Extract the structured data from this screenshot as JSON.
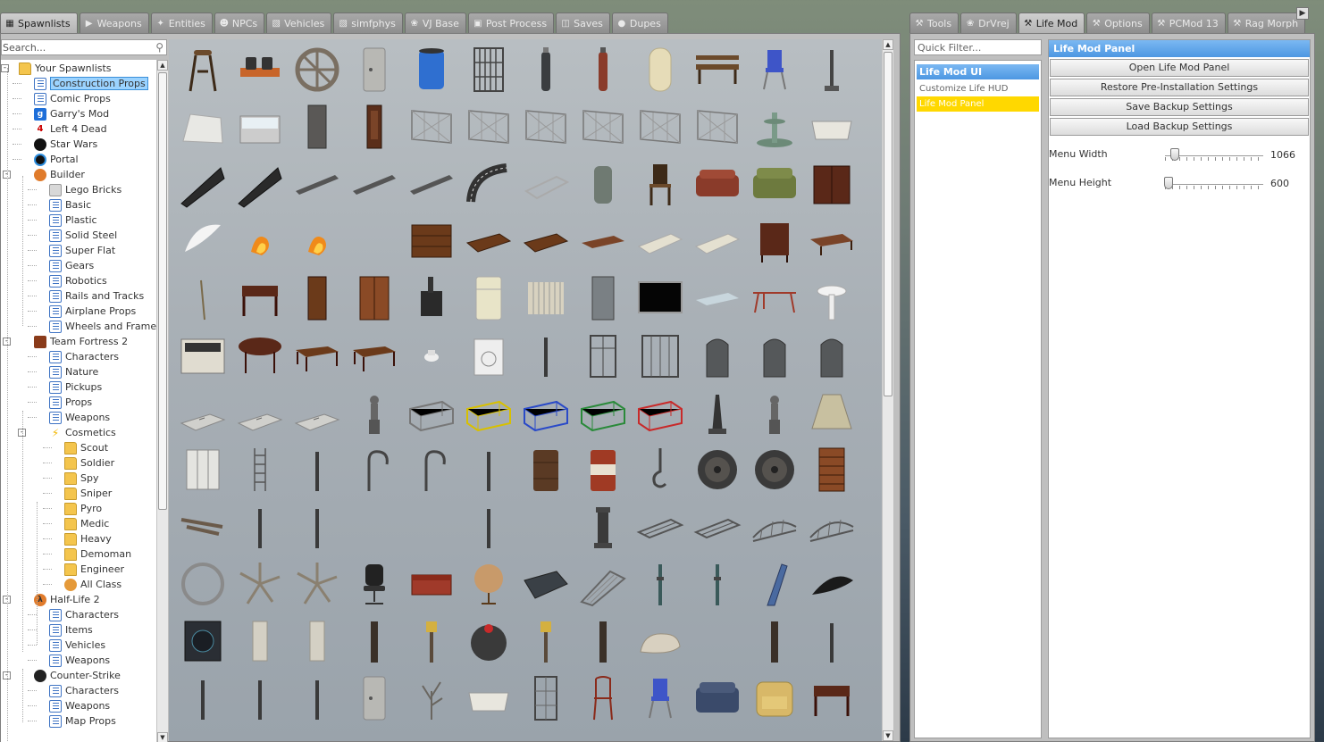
{
  "left_tabs": [
    {
      "label": "Spawnlists",
      "icon": "grid-icon",
      "active": true
    },
    {
      "label": "Weapons",
      "icon": "gun-icon"
    },
    {
      "label": "Entities",
      "icon": "entities-icon"
    },
    {
      "label": "NPCs",
      "icon": "monkey-icon"
    },
    {
      "label": "Vehicles",
      "icon": "car-icon"
    },
    {
      "label": "simfphys",
      "icon": "car-icon"
    },
    {
      "label": "VJ Base",
      "icon": "vj-icon"
    },
    {
      "label": "Post Process",
      "icon": "image-icon"
    },
    {
      "label": "Saves",
      "icon": "save-icon"
    },
    {
      "label": "Dupes",
      "icon": "dupe-icon"
    }
  ],
  "search": {
    "placeholder": "Search..."
  },
  "tree": [
    {
      "label": "Your Spawnlists",
      "icon": "folder",
      "depth": 0,
      "expander": "-"
    },
    {
      "label": "Construction Props",
      "icon": "page",
      "depth": 1,
      "selected": true
    },
    {
      "label": "Comic Props",
      "icon": "page",
      "depth": 1
    },
    {
      "label": "Garry's Mod",
      "icon": "gmod",
      "depth": 1
    },
    {
      "label": "Left 4 Dead",
      "icon": "l4d",
      "depth": 1
    },
    {
      "label": "Star Wars",
      "icon": "sw",
      "depth": 1
    },
    {
      "label": "Portal",
      "icon": "portal",
      "depth": 1
    },
    {
      "label": "Builder",
      "icon": "builder",
      "depth": 1,
      "expander": "-"
    },
    {
      "label": "Lego Bricks",
      "icon": "lego",
      "depth": 2
    },
    {
      "label": "Basic",
      "icon": "page",
      "depth": 2
    },
    {
      "label": "Plastic",
      "icon": "page",
      "depth": 2
    },
    {
      "label": "Solid Steel",
      "icon": "page",
      "depth": 2
    },
    {
      "label": "Super Flat",
      "icon": "page",
      "depth": 2
    },
    {
      "label": "Gears",
      "icon": "page",
      "depth": 2
    },
    {
      "label": "Robotics",
      "icon": "page",
      "depth": 2
    },
    {
      "label": "Rails and Tracks",
      "icon": "page",
      "depth": 2
    },
    {
      "label": "Airplane Props",
      "icon": "page",
      "depth": 2
    },
    {
      "label": "Wheels and Frames",
      "icon": "page",
      "depth": 2
    },
    {
      "label": "Team Fortress 2",
      "icon": "tf2",
      "depth": 1,
      "expander": "-"
    },
    {
      "label": "Characters",
      "icon": "page",
      "depth": 2
    },
    {
      "label": "Nature",
      "icon": "page",
      "depth": 2
    },
    {
      "label": "Pickups",
      "icon": "page",
      "depth": 2
    },
    {
      "label": "Props",
      "icon": "page",
      "depth": 2
    },
    {
      "label": "Weapons",
      "icon": "page",
      "depth": 2
    },
    {
      "label": "Cosmetics",
      "icon": "bolt",
      "depth": 2,
      "expander": "-"
    },
    {
      "label": "Scout",
      "icon": "folder",
      "depth": 3
    },
    {
      "label": "Soldier",
      "icon": "folder",
      "depth": 3
    },
    {
      "label": "Spy",
      "icon": "folder",
      "depth": 3
    },
    {
      "label": "Sniper",
      "icon": "folder",
      "depth": 3
    },
    {
      "label": "Pyro",
      "icon": "folder",
      "depth": 3
    },
    {
      "label": "Medic",
      "icon": "folder",
      "depth": 3
    },
    {
      "label": "Heavy",
      "icon": "folder",
      "depth": 3
    },
    {
      "label": "Demoman",
      "icon": "folder",
      "depth": 3
    },
    {
      "label": "Engineer",
      "icon": "folder",
      "depth": 3
    },
    {
      "label": "All Class",
      "icon": "users",
      "depth": 3
    },
    {
      "label": "Half-Life 2",
      "icon": "hl2",
      "depth": 1,
      "expander": "-"
    },
    {
      "label": "Characters",
      "icon": "page",
      "depth": 2
    },
    {
      "label": "Items",
      "icon": "page",
      "depth": 2
    },
    {
      "label": "Vehicles",
      "icon": "page",
      "depth": 2
    },
    {
      "label": "Weapons",
      "icon": "page",
      "depth": 2
    },
    {
      "label": "Counter-Strike",
      "icon": "cs",
      "depth": 1,
      "expander": "-"
    },
    {
      "label": "Characters",
      "icon": "page",
      "depth": 2
    },
    {
      "label": "Weapons",
      "icon": "page",
      "depth": 2
    },
    {
      "label": "Map Props",
      "icon": "page",
      "depth": 2
    }
  ],
  "props": [
    "stool",
    "oil-drums",
    "valve-wheel",
    "metal-door-panel",
    "blue-barrel",
    "iron-gate",
    "gas-cylinder",
    "gas-cylinder-red",
    "propane-tank",
    "wooden-bench",
    "blue-chair",
    "lamp-post",
    "concrete-barrier",
    "display-case",
    "interior-door",
    "wooden-door",
    "chainlink-fence",
    "chainlink-fence",
    "chainlink-fence",
    "chainlink-fence",
    "chainlink-fence",
    "chainlink-fence",
    "fountain",
    "bathtub",
    "ramp",
    "ramp",
    "wooden-plank",
    "wooden-plank",
    "wooden-plank",
    "road-curve",
    "bed-frame",
    "water-heater",
    "wooden-chair",
    "red-couch",
    "green-couch",
    "wooden-cabinet",
    "ghost-model",
    "fire-effect",
    "fire-effect",
    "blank",
    "dresser",
    "drawer",
    "drawer",
    "board",
    "mattress",
    "mattress",
    "wardrobe-small",
    "table-low",
    "stick",
    "desk",
    "tall-cabinet",
    "wardrobe",
    "wood-stove",
    "fridge",
    "radiator",
    "metal-locker",
    "tv-screen",
    "glass-pane",
    "rack",
    "sink",
    "stove",
    "round-table",
    "table",
    "table",
    "toilet",
    "washing-machine",
    "pole",
    "metal-door",
    "double-door",
    "gravestone",
    "gravestone",
    "gravestone",
    "gravestone-flat",
    "gravestone-flat",
    "gravestone-flat",
    "statue",
    "cage-grey",
    "cage-yellow",
    "cage-blue",
    "cage-green",
    "cage-red",
    "obelisk",
    "statue",
    "lamp-shade",
    "lockers",
    "ladder",
    "pole",
    "hook",
    "hook",
    "pole",
    "rusty-barrel",
    "rusty-barrel-red",
    "crane-hook",
    "cable-spool",
    "cable-spool",
    "bookshelf",
    "plank-debris",
    "pole",
    "pole",
    "blank",
    "blank",
    "pole",
    "blank",
    "pedestal",
    "catwalk",
    "catwalk",
    "truss-bridge",
    "truss-bridge",
    "wheel-ring",
    "windmill",
    "windmill",
    "office-chair",
    "red-chest",
    "globe",
    "metal-panel",
    "ramp-metal",
    "pipe",
    "pipe",
    "slide",
    "blade",
    "speaker",
    "wooden-panel",
    "wooden-panel",
    "post",
    "sign-post",
    "bomb",
    "sign-post",
    "post",
    "stone-lion",
    "blank",
    "post",
    "pole",
    "pole",
    "pole",
    "pole",
    "metal-door-panel",
    "dead-tree",
    "bathtub",
    "glass-door",
    "bistro-chair",
    "blue-chair",
    "blue-couch",
    "yellow-armchair",
    "desk"
  ],
  "right_tabs": [
    {
      "label": "Tools",
      "icon": "wrench-icon"
    },
    {
      "label": "DrVrej",
      "icon": "vj-icon"
    },
    {
      "label": "Life Mod",
      "icon": "wrench-icon",
      "active": true
    },
    {
      "label": "Options",
      "icon": "wrench-icon"
    },
    {
      "label": "PCMod 13",
      "icon": "wrench-icon"
    },
    {
      "label": "Rag Morph",
      "icon": "wrench-icon"
    }
  ],
  "quick_filter": {
    "placeholder": "Quick Filter..."
  },
  "tool_list": {
    "header": "Life Mod UI",
    "items": [
      {
        "label": "Customize Life HUD",
        "active": false
      },
      {
        "label": "Life Mod Panel",
        "active": true
      }
    ]
  },
  "panel": {
    "title": "Life Mod Panel",
    "buttons": [
      "Open Life Mod Panel",
      "Restore Pre-Installation Settings",
      "Save Backup Settings",
      "Load Backup Settings"
    ],
    "sliders": [
      {
        "label": "Menu Width",
        "value": "1066",
        "fraction": 0.1
      },
      {
        "label": "Menu Height",
        "value": "600",
        "fraction": 0.04
      }
    ]
  },
  "colors": {
    "accent_blue": "#4d97e2",
    "active_yellow": "#ffd800",
    "selection_blue": "#9bd3ff"
  }
}
